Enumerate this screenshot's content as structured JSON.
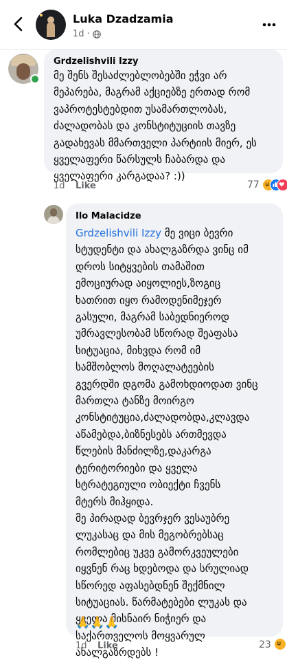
{
  "header": {
    "name": "Luka Dzadzamia",
    "time": "1d",
    "meta_sep": "·"
  },
  "comment1": {
    "author": "Grdzelishvili Izzy",
    "text": "მე შენს შესაძლებლობებში ეჭვი არ\nმეპარება, მაგრამ აქციებზე ერთად რომ\nვაპროტესტებდით უსამართლობას,\nძალადობას და კონსტიტუციის თავზე\nგადახევას მმართველი პარტიის მიერ, ეს\nყველაფერი წარსულს ჩაბარდა და\nყველაფერი კარგადაა? :))",
    "time": "1d",
    "like_label": "Like",
    "reaction_count": "77",
    "reactions": [
      "haha",
      "like",
      "love"
    ]
  },
  "comment2": {
    "author": "Ilo Malacidze",
    "mention": "Grdzelishvili Izzy",
    "text": "მე ვიცი ბევრი\nსტუდენტი  და ახალგაზრდა ვინც იმ\nდროს სიტყვების თამაშით\nემოციურად აიყოლიეს,ზოგიც\nხათრით იყო რამოდენიმეჯერ\nგასული, მაგრამ საბედნიეროდ\nუმრავლესობამ სწორად შეაფასა\nსიტუაცია, მიხვდა რომ იმ\nსამშობლოს მოღალატეების\nგვერდში დგომა გამოხდიოდათ ვინც\nმართლა ტანზე მოირგო\nკონსტიტუცია,ძალადობდა,კლავდა\nაწამებდა,ბიზნესებს ართმევდა\nწლების მანძილზე,დაკარგა\nტერიტორიები და ყველა\nსტრატეგიული ობიექტი ჩვენს\nმტერს მიჰყიდა.\nმე  პირადად ბევრჯერ ვესაუბრე\nლუკასაც და მის მეგობრებსაც\nრომლებიც  უკვე გამორკვეულები\nიყვნენ რაც ხდებოდა და სრულიად\nსწორედ აფასებდნენ შექმნილ\nსიტუაციას. წარმატებები ლუკას და\nყველა მისნაირ  ნიჭიერ და\nსაქართველოს მოყვარულ\nახალგაზრდებს !",
    "emojis": "🙏🙏🙏",
    "time": "1d",
    "like_label": "Like",
    "reaction_count": "23",
    "reactions": [
      "haha"
    ]
  },
  "colors": {
    "bubble": "#f0f2f5",
    "mention": "#216fdb",
    "secondary_text": "#65676b",
    "online": "#31a24c",
    "like_blue": "#1877f2",
    "love_red": "#f33e58",
    "haha_yellow": "#f7b125"
  }
}
